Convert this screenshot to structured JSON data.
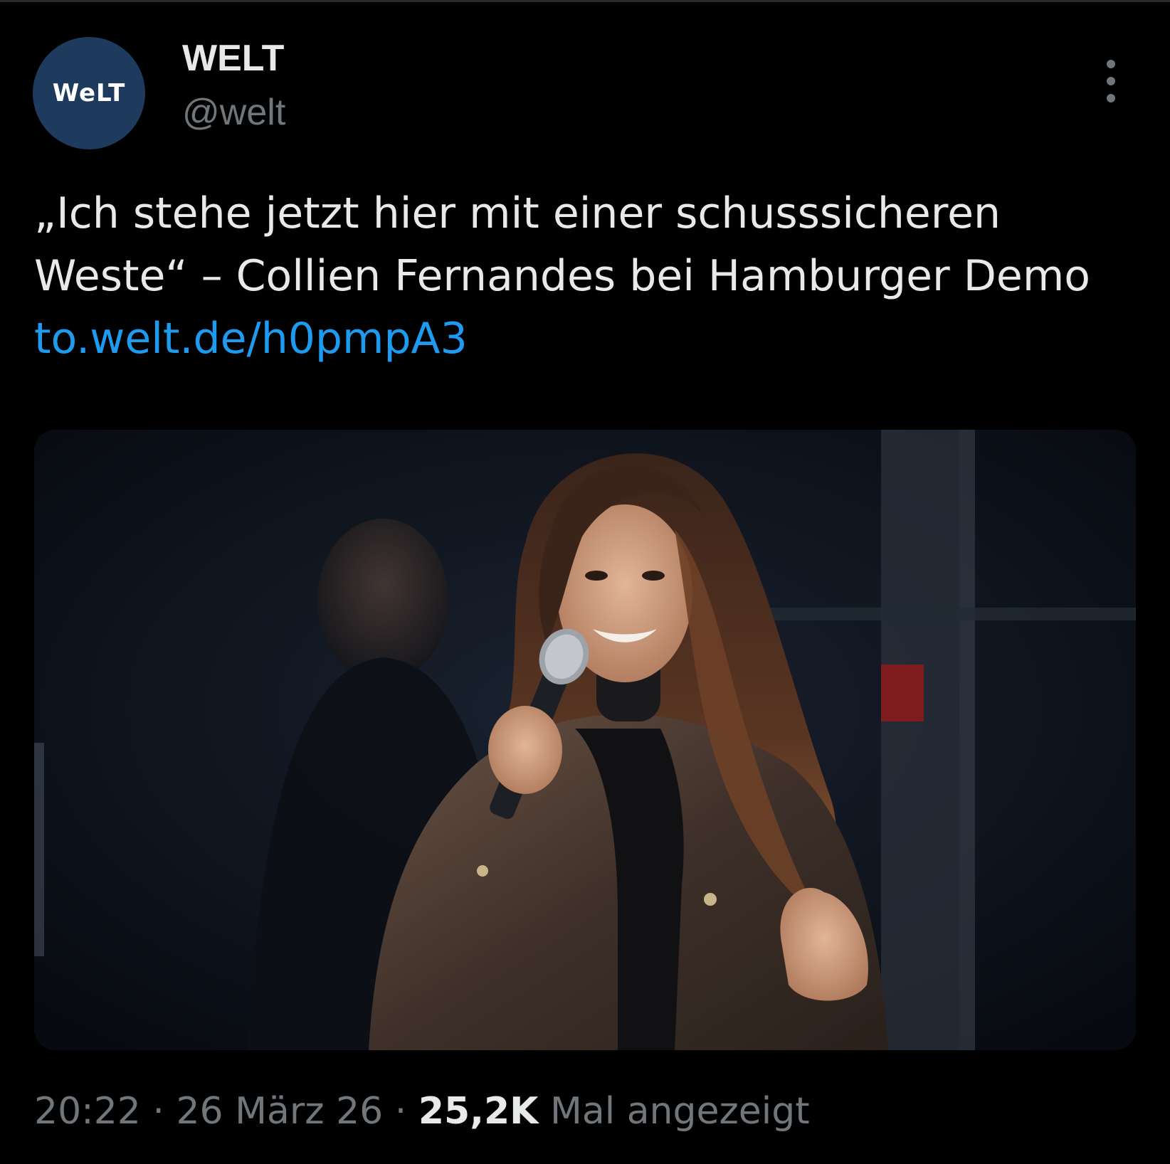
{
  "account": {
    "avatar_text": "WeLT",
    "name": "WELT",
    "handle": "@welt"
  },
  "tweet": {
    "text": "„Ich stehe jetzt hier mit einer schusssicheren Weste“ – Collien Fernandes bei Hamburger Demo ",
    "link": "to.welt.de/h0pmpA3",
    "time": "20:22",
    "date": "26 März 26",
    "views_count": "25,2K",
    "views_label": "Mal angezeigt"
  },
  "media": {
    "description_icon": "photo-icon"
  },
  "colors": {
    "background": "#000000",
    "text": "#e7e9ea",
    "secondary": "#71767b",
    "link": "#1d9bf0",
    "avatar_bg": "#1e3b5e"
  }
}
